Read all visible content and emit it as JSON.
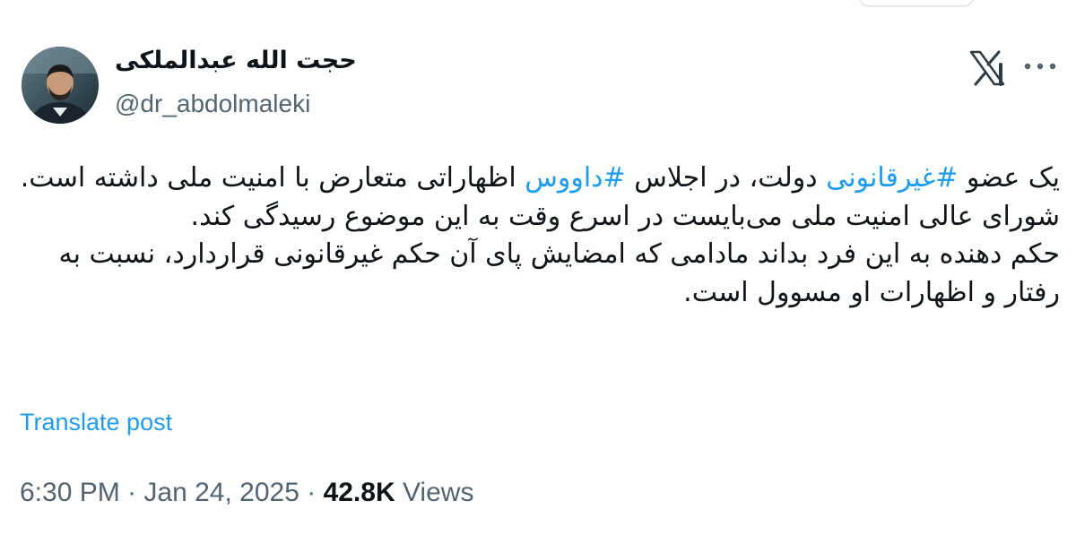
{
  "author": {
    "display_name": "حجت الله عبدالملکی",
    "handle": "@dr_abdolmaleki"
  },
  "icons": {
    "platform_logo": "x-logo-icon",
    "more": "more-options-icon"
  },
  "tweet": {
    "p1_part1": "یک عضو ",
    "hashtag1": "#غیرقانونی",
    "p1_part2": " دولت، در اجلاس ",
    "hashtag2": "#داووس",
    "p1_part3": " اظهاراتی متعارض با امنیت ملی داشته است. شورای عالی امنیت ملی می‌بایست در اسرع وقت به این موضوع رسیدگی کند.",
    "p2": "حکم دهنده به این فرد بداند مادامی که امضایش پای آن حکم غیرقانونی قراردارد، نسبت به رفتار و اظهارات او مسوول است."
  },
  "translate_label": "Translate post",
  "meta": {
    "time": "6:30 PM",
    "separator": " · ",
    "date": "Jan 24, 2025",
    "views_count": "42.8K",
    "views_label": "Views"
  },
  "colors": {
    "accent": "#1d9bf0",
    "text": "#0f1419",
    "secondary": "#536471"
  }
}
